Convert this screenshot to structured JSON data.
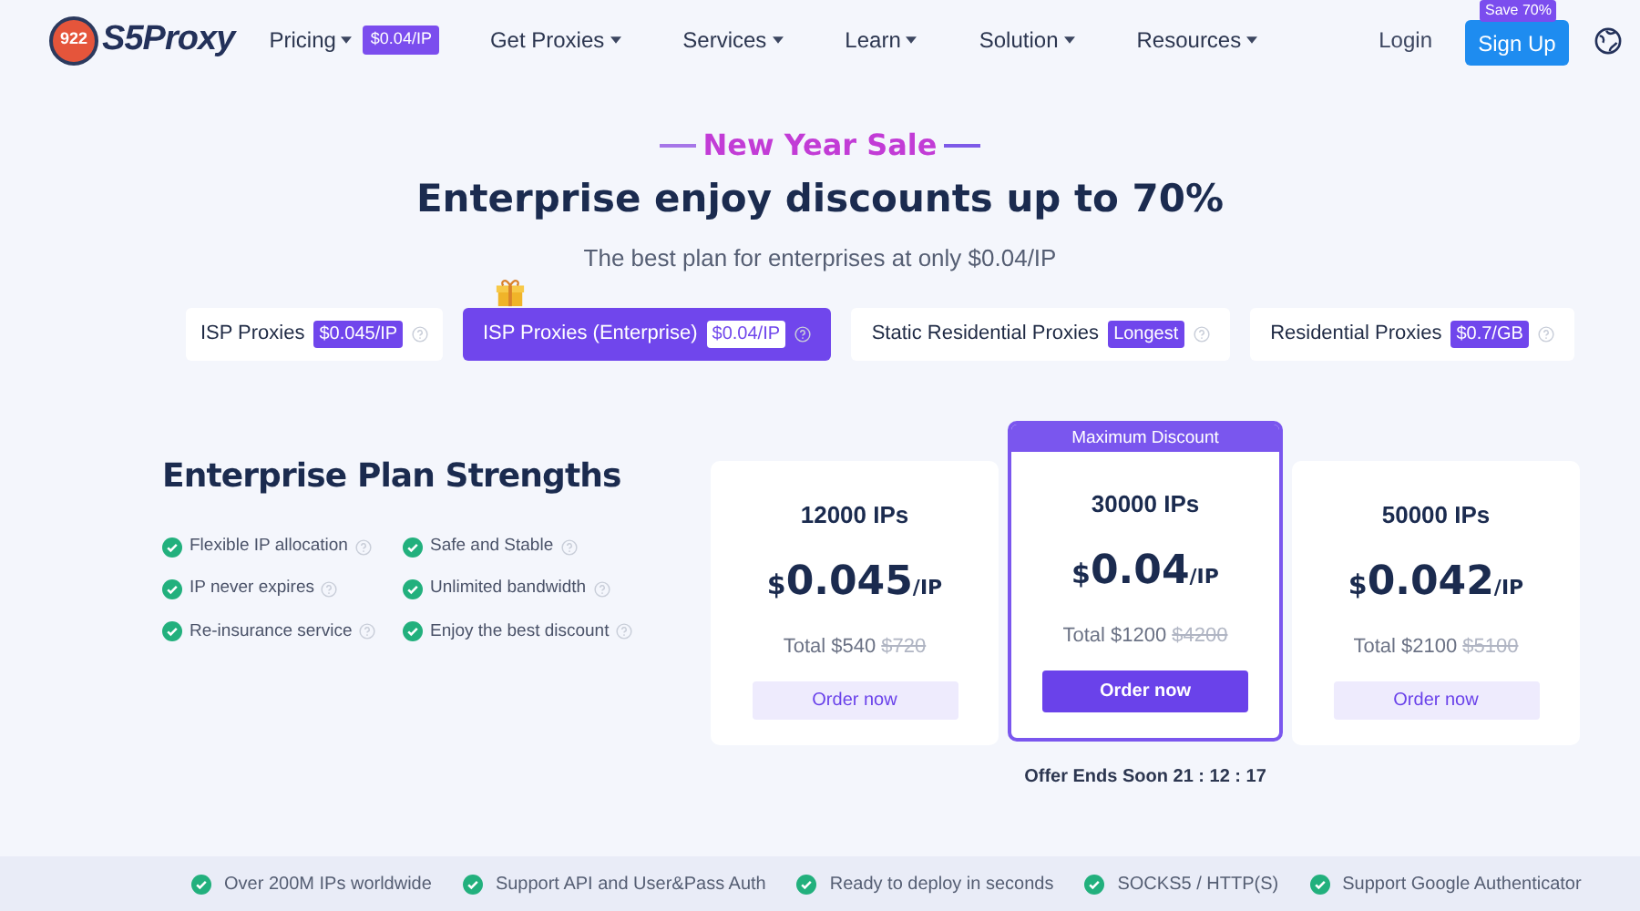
{
  "nav": {
    "logo_badge": "922",
    "logo_text": "S5Proxy",
    "items": [
      {
        "label": "Pricing",
        "badge": "$0.04/IP"
      },
      {
        "label": "Get Proxies"
      },
      {
        "label": "Services"
      },
      {
        "label": "Learn"
      },
      {
        "label": "Solution"
      },
      {
        "label": "Resources"
      }
    ],
    "login": "Login",
    "signup": "Sign Up",
    "signup_badge": "Save 70%"
  },
  "hero": {
    "sale": "New Year Sale",
    "title": "Enterprise enjoy discounts up to 70%",
    "subtitle": "The best plan for enterprises at only $0.04/IP"
  },
  "tabs": [
    {
      "label": "ISP Proxies",
      "badge": "$0.045/IP",
      "selected": false
    },
    {
      "label": "ISP Proxies (Enterprise)",
      "badge": "$0.04/IP",
      "selected": true
    },
    {
      "label": "Static Residential Proxies",
      "badge": "Longest",
      "selected": false
    },
    {
      "label": "Residential Proxies",
      "badge": "$0.7/GB",
      "selected": false
    }
  ],
  "strengths": {
    "title": "Enterprise Plan Strengths",
    "items": [
      "Flexible IP allocation",
      "Safe and Stable",
      "IP never expires",
      "Unlimited bandwidth",
      "Re-insurance service",
      "Enjoy the best discount"
    ]
  },
  "plans": [
    {
      "ips": "12000 IPs",
      "currency": "$",
      "price": "0.045",
      "unit": "/IP",
      "total": "Total $540",
      "old": "$720",
      "button": "Order now",
      "featured": false
    },
    {
      "ips": "30000 IPs",
      "currency": "$",
      "price": "0.04",
      "unit": "/IP",
      "total": "Total $1200",
      "old": "$4200",
      "button": "Order now",
      "featured": true,
      "ribbon": "Maximum Discount"
    },
    {
      "ips": "50000 IPs",
      "currency": "$",
      "price": "0.042",
      "unit": "/IP",
      "total": "Total $2100",
      "old": "$5100",
      "button": "Order now",
      "featured": false
    }
  ],
  "offer": "Offer Ends Soon 21 : 12 : 17",
  "features": [
    "Over 200M IPs worldwide",
    "Support API and User&Pass Auth",
    "Ready to deploy in seconds",
    "SOCKS5 / HTTP(S)",
    "Support Google Authenticator"
  ]
}
